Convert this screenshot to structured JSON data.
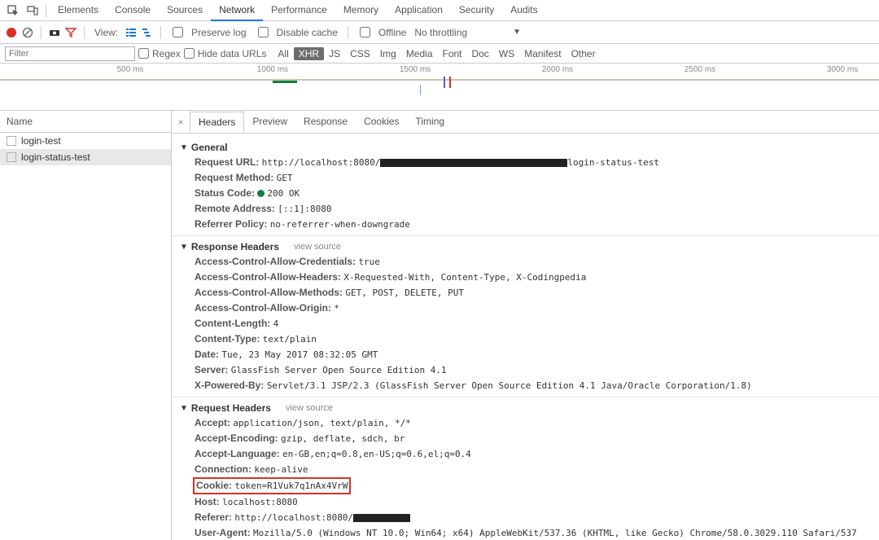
{
  "topTabs": {
    "items": [
      "Elements",
      "Console",
      "Sources",
      "Network",
      "Performance",
      "Memory",
      "Application",
      "Security",
      "Audits"
    ],
    "activeIndex": 3
  },
  "toolbar": {
    "viewLabel": "View:",
    "preserveLog": "Preserve log",
    "disableCache": "Disable cache",
    "offline": "Offline",
    "throttling": "No throttling"
  },
  "filterbar": {
    "placeholder": "Filter",
    "regexLabel": "Regex",
    "hideDataLabel": "Hide data URLs",
    "types": [
      "All",
      "XHR",
      "JS",
      "CSS",
      "Img",
      "Media",
      "Font",
      "Doc",
      "WS",
      "Manifest",
      "Other"
    ],
    "activeType": "XHR"
  },
  "timeline": {
    "ticks": [
      "500 ms",
      "1000 ms",
      "1500 ms",
      "2000 ms",
      "2500 ms",
      "3000 ms"
    ]
  },
  "names": {
    "header": "Name",
    "rows": [
      "login-test",
      "login-status-test"
    ],
    "selectedIndex": 1
  },
  "detailTabs": {
    "items": [
      "Headers",
      "Preview",
      "Response",
      "Cookies",
      "Timing"
    ],
    "activeIndex": 0
  },
  "headers": {
    "general": {
      "title": "General",
      "items": [
        {
          "k": "Request URL:",
          "v": "http://localhost:8080/",
          "suffix": "login-status-test",
          "redactW": 230
        },
        {
          "k": "Request Method:",
          "v": "GET"
        },
        {
          "k": "Status Code:",
          "v": "200 OK",
          "status": true
        },
        {
          "k": "Remote Address:",
          "v": "[::1]:8080"
        },
        {
          "k": "Referrer Policy:",
          "v": "no-referrer-when-downgrade"
        }
      ]
    },
    "response": {
      "title": "Response Headers",
      "viewSource": "view source",
      "items": [
        {
          "k": "Access-Control-Allow-Credentials:",
          "v": "true"
        },
        {
          "k": "Access-Control-Allow-Headers:",
          "v": "X-Requested-With, Content-Type, X-Codingpedia"
        },
        {
          "k": "Access-Control-Allow-Methods:",
          "v": "GET, POST, DELETE, PUT"
        },
        {
          "k": "Access-Control-Allow-Origin:",
          "v": "*"
        },
        {
          "k": "Content-Length:",
          "v": "4"
        },
        {
          "k": "Content-Type:",
          "v": "text/plain"
        },
        {
          "k": "Date:",
          "v": "Tue, 23 May 2017 08:32:05 GMT"
        },
        {
          "k": "Server:",
          "v": "GlassFish Server Open Source Edition  4.1"
        },
        {
          "k": "X-Powered-By:",
          "v": "Servlet/3.1 JSP/2.3 (GlassFish Server Open Source Edition  4.1  Java/Oracle Corporation/1.8)"
        }
      ]
    },
    "request": {
      "title": "Request Headers",
      "viewSource": "view source",
      "items": [
        {
          "k": "Accept:",
          "v": "application/json, text/plain, */*"
        },
        {
          "k": "Accept-Encoding:",
          "v": "gzip, deflate, sdch, br"
        },
        {
          "k": "Accept-Language:",
          "v": "en-GB,en;q=0.8,en-US;q=0.6,el;q=0.4"
        },
        {
          "k": "Connection:",
          "v": "keep-alive"
        },
        {
          "k": "Cookie:",
          "v": "token=R1Vuk7q1nAx4VrW",
          "highlight": true
        },
        {
          "k": "Host:",
          "v": "localhost:8080"
        },
        {
          "k": "Referer:",
          "v": "http://localhost:8080/",
          "redactW": 70
        },
        {
          "k": "User-Agent:",
          "v": "Mozilla/5.0 (Windows NT 10.0; Win64; x64) AppleWebKit/537.36 (KHTML, like Gecko) Chrome/58.0.3029.110 Safari/537"
        }
      ]
    }
  }
}
